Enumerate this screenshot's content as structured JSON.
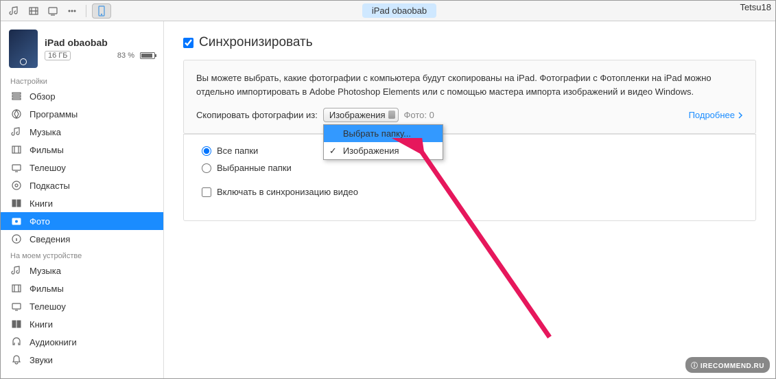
{
  "watermark_top": "Tetsu18",
  "watermark_bottom": "IRECOMMEND.RU",
  "toolbar": {
    "device_pill": "iPad obaobab"
  },
  "device": {
    "name": "iPad obaobab",
    "capacity": "16 ГБ",
    "battery_pct": "83 %"
  },
  "sidebar": {
    "section_settings": "Настройки",
    "section_on_device": "На моем устройстве",
    "settings_items": [
      {
        "label": "Обзор"
      },
      {
        "label": "Программы"
      },
      {
        "label": "Музыка"
      },
      {
        "label": "Фильмы"
      },
      {
        "label": "Телешоу"
      },
      {
        "label": "Подкасты"
      },
      {
        "label": "Книги"
      },
      {
        "label": "Фото"
      },
      {
        "label": "Сведения"
      }
    ],
    "device_items": [
      {
        "label": "Музыка"
      },
      {
        "label": "Фильмы"
      },
      {
        "label": "Телешоу"
      },
      {
        "label": "Книги"
      },
      {
        "label": "Аудиокниги"
      },
      {
        "label": "Звуки"
      }
    ]
  },
  "main": {
    "sync_label": "Синхронизировать",
    "description": "Вы можете выбрать, какие фотографии с компьютера будут скопированы на iPad. Фотографии с Фотопленки на iPad можно отдельно импортировать в Adobe Photoshop Elements или с помощью мастера импорта изображений и видео Windows.",
    "copy_from_label": "Скопировать фотографии из:",
    "source_selected": "Изображения",
    "photo_count_label": "Фото: 0",
    "more_link": "Подробнее",
    "dropdown": {
      "choose_folder": "Выбрать папку...",
      "images": "Изображения"
    },
    "options": {
      "all_folders": "Все папки",
      "selected_folders": "Выбранные папки",
      "include_video": "Включать в синхронизацию видео"
    }
  }
}
